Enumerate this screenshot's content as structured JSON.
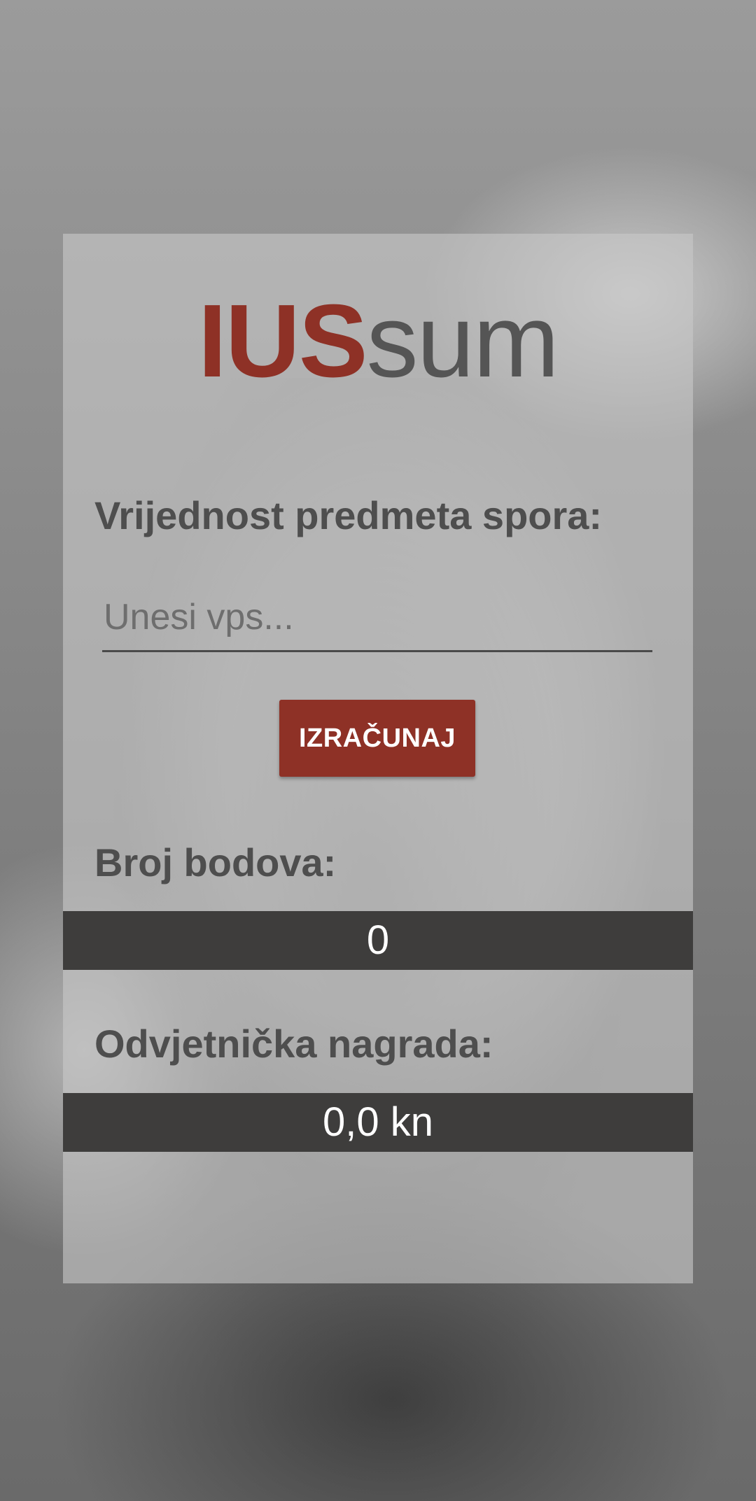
{
  "app": {
    "logo_part1": "IUS",
    "logo_part2": "sum"
  },
  "form": {
    "vps_label": "Vrijednost predmeta spora:",
    "vps_placeholder": "Unesi vps...",
    "vps_value": "",
    "calculate_label": "IZRAČUNAJ"
  },
  "results": {
    "points_label": "Broj bodova:",
    "points_value": "0",
    "fee_label": "Odvjetnička nagrada:",
    "fee_value": "0,0 kn"
  },
  "colors": {
    "accent": "#8e3126",
    "logo_gray": "#555555",
    "result_bar": "#3e3d3c"
  }
}
